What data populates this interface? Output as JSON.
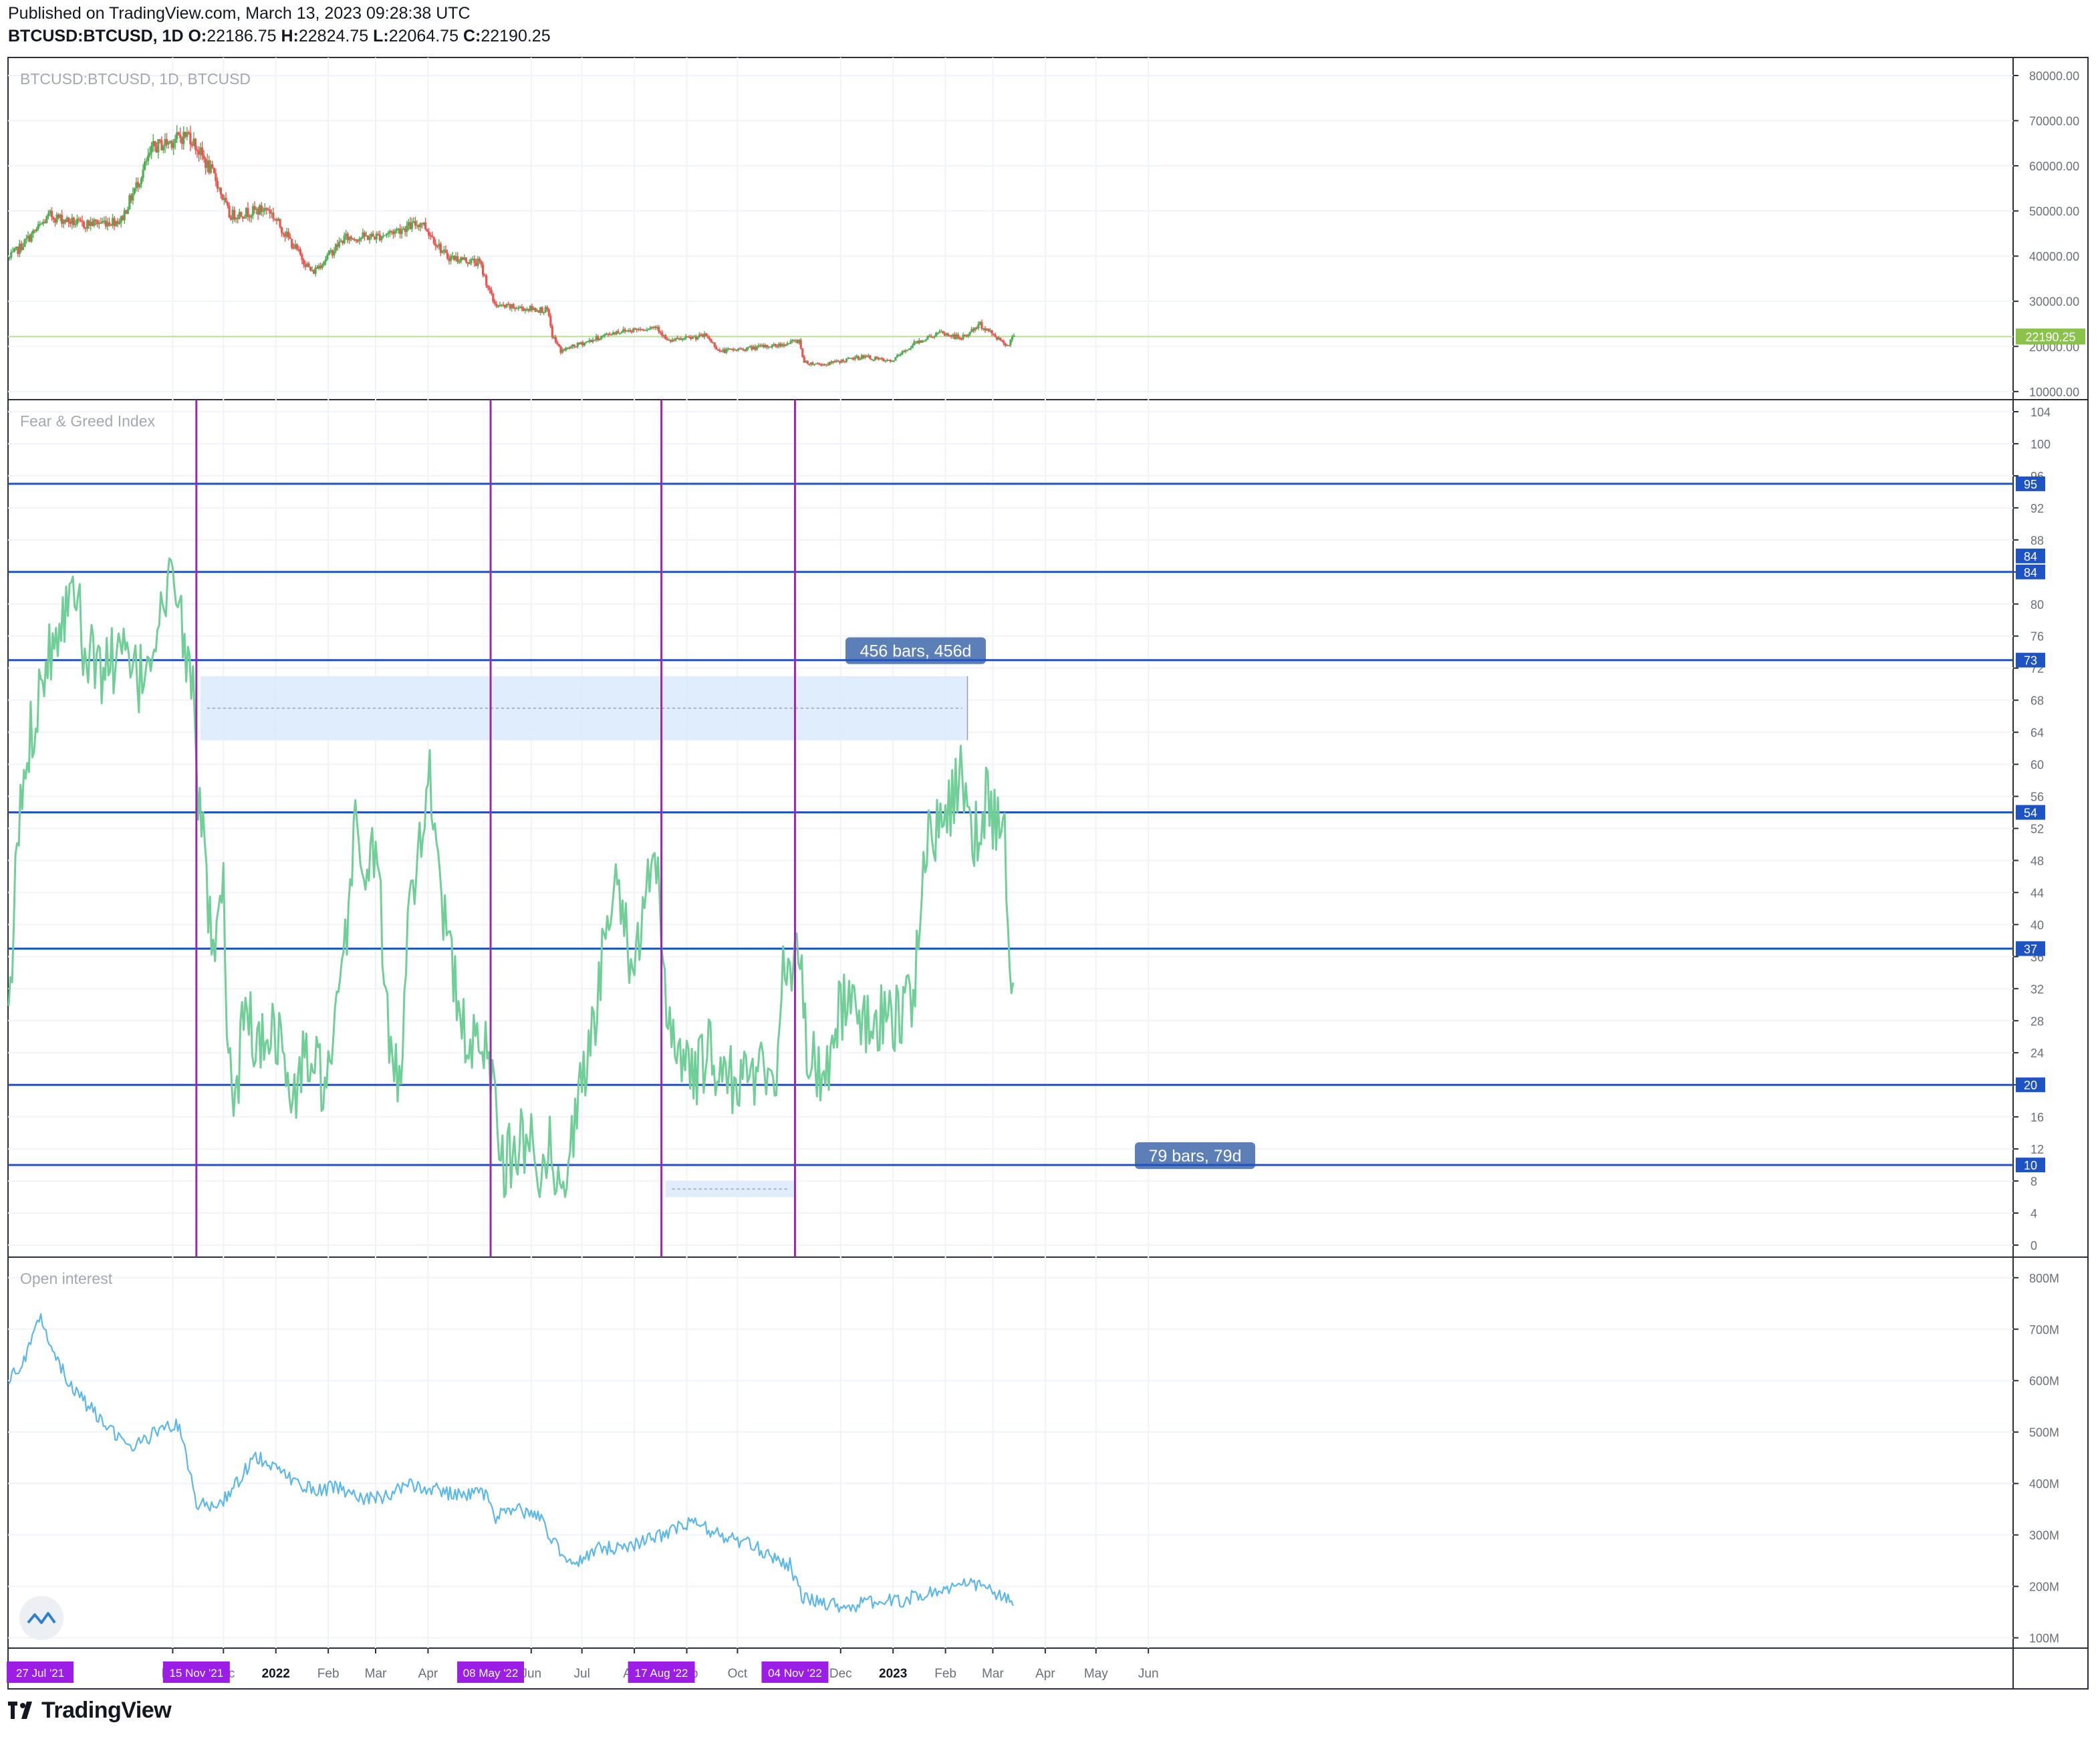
{
  "header": {
    "published": "Published on TradingView.com, March 13, 2023 09:28:38 UTC",
    "symbol": "BTCUSD:BTCUSD, 1D",
    "open_label": "O:",
    "open": "22186.75",
    "high_label": "H:",
    "high": "22824.75",
    "low_label": "L:",
    "low": "22064.75",
    "close_label": "C:",
    "close": "22190.25"
  },
  "footer": {
    "brand": "TradingView"
  },
  "chart_data": [
    {
      "type": "candlestick",
      "title": "BTCUSD:BTCUSD, 1D, BTCUSD",
      "ylim": [
        10000,
        80000
      ],
      "yticks": [
        "80000.00",
        "70000.00",
        "60000.00",
        "50000.00",
        "40000.00",
        "30000.00",
        "20000.00",
        "10000.00"
      ],
      "last_price_label": "22190.25",
      "last_price": 22190.25,
      "x_dates": [
        "2021-07-27",
        "2021-08-20",
        "2021-09-07",
        "2021-10-01",
        "2021-10-20",
        "2021-11-10",
        "2021-11-26",
        "2021-12-04",
        "2021-12-27",
        "2022-01-22",
        "2022-02-10",
        "2022-03-02",
        "2022-03-28",
        "2022-04-11",
        "2022-05-01",
        "2022-05-09",
        "2022-05-12",
        "2022-06-10",
        "2022-06-13",
        "2022-06-18",
        "2022-07-20",
        "2022-08-14",
        "2022-08-20",
        "2022-09-12",
        "2022-09-20",
        "2022-10-25",
        "2022-11-06",
        "2022-11-09",
        "2022-11-21",
        "2022-12-14",
        "2022-12-30",
        "2023-01-14",
        "2023-01-28",
        "2023-02-10",
        "2023-02-21",
        "2023-03-09",
        "2023-03-13"
      ],
      "close_values": [
        39500,
        49000,
        47000,
        48000,
        64000,
        67000,
        57000,
        49000,
        50500,
        36300,
        44000,
        44400,
        47500,
        40000,
        38500,
        30000,
        28900,
        28000,
        22400,
        19000,
        23200,
        24400,
        21100,
        22400,
        18900,
        20300,
        21300,
        16400,
        16000,
        17800,
        16550,
        20900,
        23000,
        21800,
        24800,
        20300,
        22190
      ]
    },
    {
      "type": "line",
      "title": "Fear & Greed Index",
      "ylim": [
        -1.5,
        105.5
      ],
      "yticks": [
        "104",
        "100",
        "96",
        "92",
        "88",
        "84",
        "80",
        "76",
        "72",
        "68",
        "64",
        "60",
        "56",
        "52",
        "48",
        "44",
        "40",
        "36",
        "32",
        "28",
        "24",
        "20",
        "16",
        "12",
        "8",
        "4",
        "0"
      ],
      "hlines": [
        {
          "label": "95",
          "value": 95
        },
        {
          "label": "84",
          "value": 84
        },
        {
          "label": "73",
          "value": 73
        },
        {
          "label": "54",
          "value": 54
        },
        {
          "label": "37",
          "value": 37
        },
        {
          "label": "20",
          "value": 20
        },
        {
          "label": "10",
          "value": 10
        }
      ],
      "extra_labels": [
        {
          "label": "84",
          "value": 86
        }
      ],
      "x_dates": [
        "2021-07-27",
        "2021-08-01",
        "2021-08-06",
        "2021-08-16",
        "2021-08-26",
        "2021-09-07",
        "2021-09-09",
        "2021-09-20",
        "2021-10-01",
        "2021-10-12",
        "2021-10-24",
        "2021-11-03",
        "2021-11-09",
        "2021-11-14",
        "2021-11-16",
        "2021-11-19",
        "2021-11-25",
        "2021-12-01",
        "2021-12-04",
        "2021-12-08",
        "2021-12-14",
        "2021-12-22",
        "2021-12-29",
        "2022-01-06",
        "2022-01-10",
        "2022-01-18",
        "2022-01-24",
        "2022-02-01",
        "2022-02-10",
        "2022-02-17",
        "2022-02-24",
        "2022-03-01",
        "2022-03-09",
        "2022-03-16",
        "2022-03-20",
        "2022-03-28",
        "2022-04-01",
        "2022-04-06",
        "2022-04-11",
        "2022-04-20",
        "2022-04-26",
        "2022-05-04",
        "2022-05-08",
        "2022-05-10",
        "2022-05-16",
        "2022-05-24",
        "2022-06-01",
        "2022-06-06",
        "2022-06-12",
        "2022-06-18",
        "2022-06-25",
        "2022-07-03",
        "2022-07-10",
        "2022-07-20",
        "2022-07-30",
        "2022-08-03",
        "2022-08-08",
        "2022-08-14",
        "2022-08-17",
        "2022-08-20",
        "2022-08-28",
        "2022-09-05",
        "2022-09-13",
        "2022-09-20",
        "2022-10-01",
        "2022-10-12",
        "2022-10-24",
        "2022-10-29",
        "2022-11-03",
        "2022-11-07",
        "2022-11-10",
        "2022-11-20",
        "2022-12-01",
        "2022-12-15",
        "2022-12-31",
        "2023-01-08",
        "2023-01-13",
        "2023-01-20",
        "2023-01-27",
        "2023-02-03",
        "2023-02-10",
        "2023-02-13",
        "2023-02-18",
        "2023-02-25",
        "2023-03-03",
        "2023-03-08",
        "2023-03-09",
        "2023-03-13"
      ],
      "values": [
        26,
        50,
        60,
        72,
        78,
        84,
        74,
        72,
        74,
        70,
        78,
        84,
        72,
        70,
        54,
        50,
        34,
        44,
        22,
        18,
        30,
        24,
        28,
        24,
        16,
        24,
        22,
        20,
        34,
        54,
        44,
        52,
        24,
        20,
        44,
        50,
        60,
        52,
        40,
        28,
        24,
        26,
        22,
        20,
        10,
        12,
        14,
        10,
        12,
        6,
        14,
        22,
        30,
        48,
        36,
        36,
        44,
        46,
        40,
        30,
        24,
        20,
        24,
        22,
        20,
        22,
        22,
        36,
        34,
        38,
        26,
        20,
        30,
        28,
        28,
        30,
        31,
        50,
        52,
        54,
        58,
        58,
        50,
        56,
        52,
        50,
        44,
        33,
        48
      ]
    },
    {
      "type": "line",
      "title": "Open interest",
      "ylim": [
        80,
        840
      ],
      "yticks": [
        "800M",
        "700M",
        "600M",
        "500M",
        "400M",
        "300M",
        "200M",
        "100M"
      ],
      "x_dates": [
        "2021-07-27",
        "2021-08-05",
        "2021-08-15",
        "2021-09-01",
        "2021-09-15",
        "2021-09-22",
        "2021-10-08",
        "2021-10-25",
        "2021-11-05",
        "2021-11-15",
        "2021-11-27",
        "2021-12-05",
        "2021-12-20",
        "2022-01-05",
        "2022-01-15",
        "2022-01-25",
        "2022-02-05",
        "2022-02-20",
        "2022-03-05",
        "2022-03-20",
        "2022-04-05",
        "2022-04-20",
        "2022-05-05",
        "2022-05-10",
        "2022-05-20",
        "2022-06-05",
        "2022-06-13",
        "2022-06-25",
        "2022-07-10",
        "2022-07-25",
        "2022-08-10",
        "2022-08-20",
        "2022-09-05",
        "2022-09-20",
        "2022-10-05",
        "2022-10-20",
        "2022-11-01",
        "2022-11-09",
        "2022-11-20",
        "2022-12-05",
        "2022-12-20",
        "2023-01-05",
        "2023-01-20",
        "2023-02-05",
        "2023-02-20",
        "2023-03-01",
        "2023-03-13"
      ],
      "values": [
        600,
        640,
        720,
        590,
        540,
        510,
        470,
        505,
        515,
        360,
        355,
        380,
        455,
        420,
        400,
        385,
        395,
        370,
        375,
        395,
        390,
        375,
        382,
        330,
        350,
        340,
        295,
        240,
        272,
        278,
        290,
        305,
        325,
        300,
        285,
        262,
        242,
        175,
        170,
        160,
        170,
        172,
        185,
        198,
        205,
        190,
        165
      ]
    }
  ],
  "annotations": {
    "vlines": [
      {
        "date": "2021-11-15",
        "label": "15 Nov '21"
      },
      {
        "date": "2022-05-08",
        "label": "08 May '22"
      },
      {
        "date": "2022-08-17",
        "label": "17 Aug '22"
      },
      {
        "date": "2022-11-04",
        "label": "04 Nov '22"
      }
    ],
    "start_label": "27 Jul '21",
    "ranges": [
      {
        "start": "2021-11-15",
        "end": "2023-02-14",
        "top": 71,
        "bottom": 63,
        "label": "456 bars, 456d"
      },
      {
        "start": "2022-08-17",
        "end": "2022-11-04",
        "top": 8,
        "bottom": 6,
        "label": "79 bars, 79d"
      }
    ]
  },
  "time_axis": [
    {
      "label": "Nov",
      "date": "2021-11-01"
    },
    {
      "label": "Dec",
      "date": "2021-12-01"
    },
    {
      "label": "2022",
      "date": "2022-01-01"
    },
    {
      "label": "Feb",
      "date": "2022-02-01"
    },
    {
      "label": "Mar",
      "date": "2022-03-01"
    },
    {
      "label": "Apr",
      "date": "2022-04-01"
    },
    {
      "label": "Jun",
      "date": "2022-06-01"
    },
    {
      "label": "Jul",
      "date": "2022-07-01"
    },
    {
      "label": "Aug",
      "date": "2022-08-01"
    },
    {
      "label": "Sep",
      "date": "2022-09-01"
    },
    {
      "label": "Oct",
      "date": "2022-10-01"
    },
    {
      "label": "Dec",
      "date": "2022-12-01"
    },
    {
      "label": "2023",
      "date": "2023-01-01"
    },
    {
      "label": "Feb",
      "date": "2023-02-01"
    },
    {
      "label": "Mar",
      "date": "2023-03-01"
    },
    {
      "label": "Apr",
      "date": "2023-04-01"
    },
    {
      "label": "May",
      "date": "2023-05-01"
    },
    {
      "label": "Jun",
      "date": "2023-06-01"
    }
  ],
  "colors": {
    "up": "#26a69a",
    "up_fill": "#4caf50",
    "down": "#ef5350",
    "fng_line": "#6fcf97",
    "oi_line": "#5bb8ea",
    "hline": "#1e53c4",
    "vline": "#9c27b0",
    "vline_label": "#9c1de6",
    "range_fill": "#dbeafd",
    "range_label": "#5b7fb6",
    "price_label": "#8bc34a",
    "grid": "#f0f3fa",
    "axis_text": "#6b6f7a",
    "title_text": "#a4a8b2"
  }
}
